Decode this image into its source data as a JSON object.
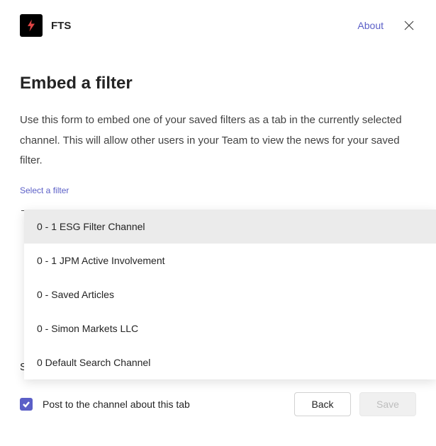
{
  "header": {
    "app_title": "FTS",
    "about_label": "About"
  },
  "main": {
    "title": "Embed a filter",
    "description": "Use this form to embed one of your saved filters as a tab in the currently selected channel. This will allow other users in your Team to view the news for your saved filter.",
    "field_label": "Select a filter",
    "dropdown_trigger": "–",
    "options": [
      "0 - 1 ESG Filter Channel",
      "0 - 1 JPM Active Involvement",
      "0 - Saved Articles",
      "0 - Simon Markets LLC",
      "0 Default Search Channel"
    ],
    "partial_text": "S"
  },
  "footer": {
    "checkbox_label": "Post to the channel about this tab",
    "back_label": "Back",
    "save_label": "Save"
  }
}
